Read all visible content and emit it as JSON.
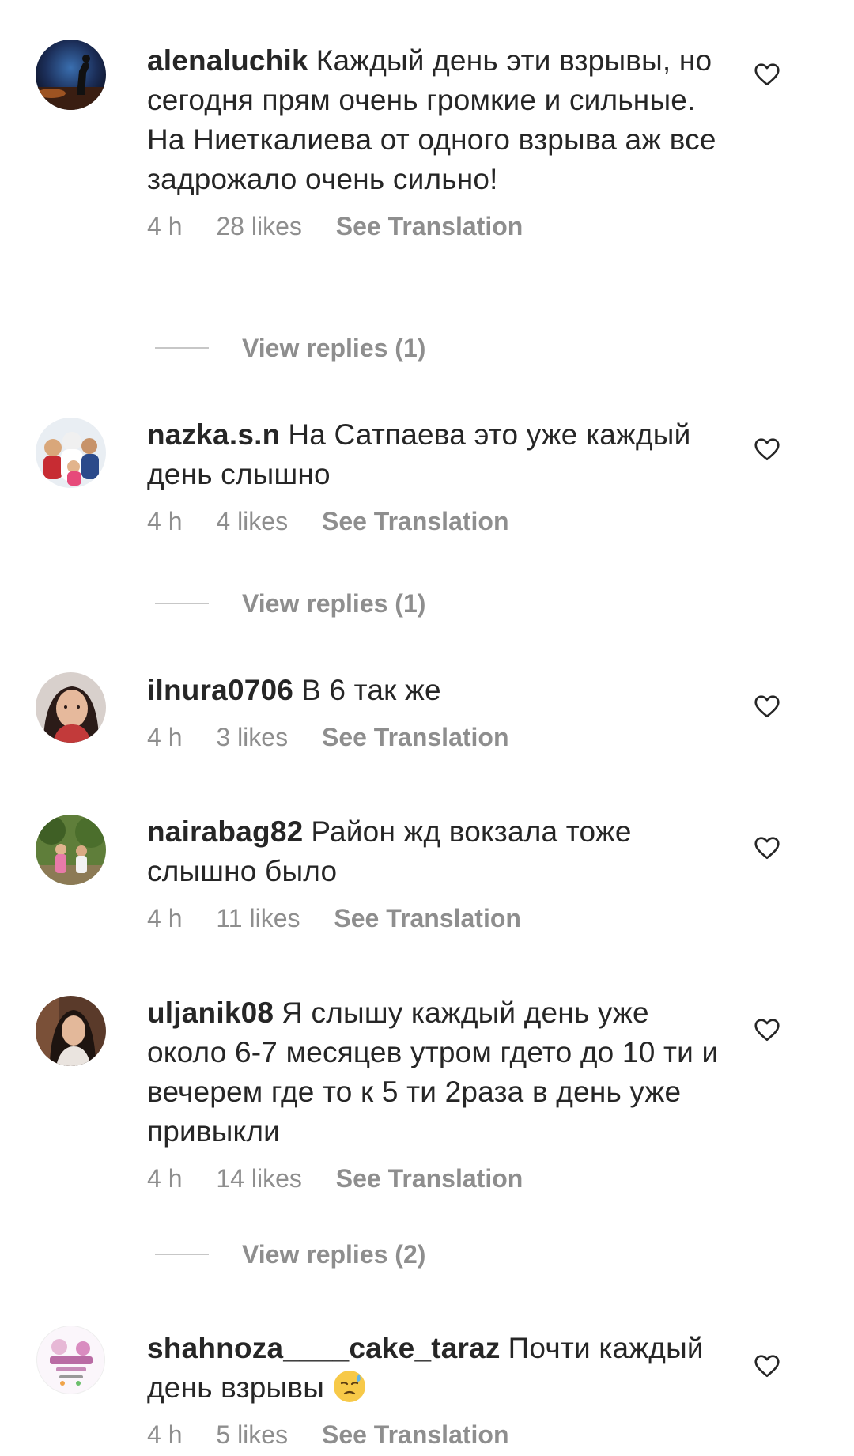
{
  "comments": [
    {
      "username": "alenaluchik",
      "text": "Каждый день эти взрывы, но сегодня прям очень громкие и сильные. На Ниеткалиева от одного взрыва аж все задрожало очень сильно!",
      "time": "4 h",
      "likes": "28 likes",
      "translate": "See Translation",
      "replies": "View replies (1)"
    },
    {
      "username": "nazka.s.n",
      "text": "На Сатпаева это уже каждый день слышно",
      "time": "4 h",
      "likes": "4 likes",
      "translate": "See Translation",
      "replies": "View replies (1)"
    },
    {
      "username": "ilnura0706",
      "text": "В 6 так же",
      "time": "4 h",
      "likes": "3 likes",
      "translate": "See Translation"
    },
    {
      "username": "nairabag82",
      "text": "Район жд вокзала тоже слышно было",
      "time": "4 h",
      "likes": "11 likes",
      "translate": "See Translation"
    },
    {
      "username": "uljanik08",
      "text": "Я слышу каждый день уже около 6-7 месяцев утром гдето до 10 ти и вечерем где то к 5 ти 2раза в день уже привыкли",
      "time": "4 h",
      "likes": "14 likes",
      "translate": "See Translation",
      "replies": "View replies (2)"
    },
    {
      "username": "shahnoza____cake_taraz",
      "text": "Почти каждый день взрывы",
      "emoji": "downcast-face-with-sweat",
      "time": "4 h",
      "likes": "5 likes",
      "translate": "See Translation"
    }
  ],
  "colors": {
    "text": "#262626",
    "secondary": "#8e8e8e",
    "divider": "#c7c7c7"
  }
}
